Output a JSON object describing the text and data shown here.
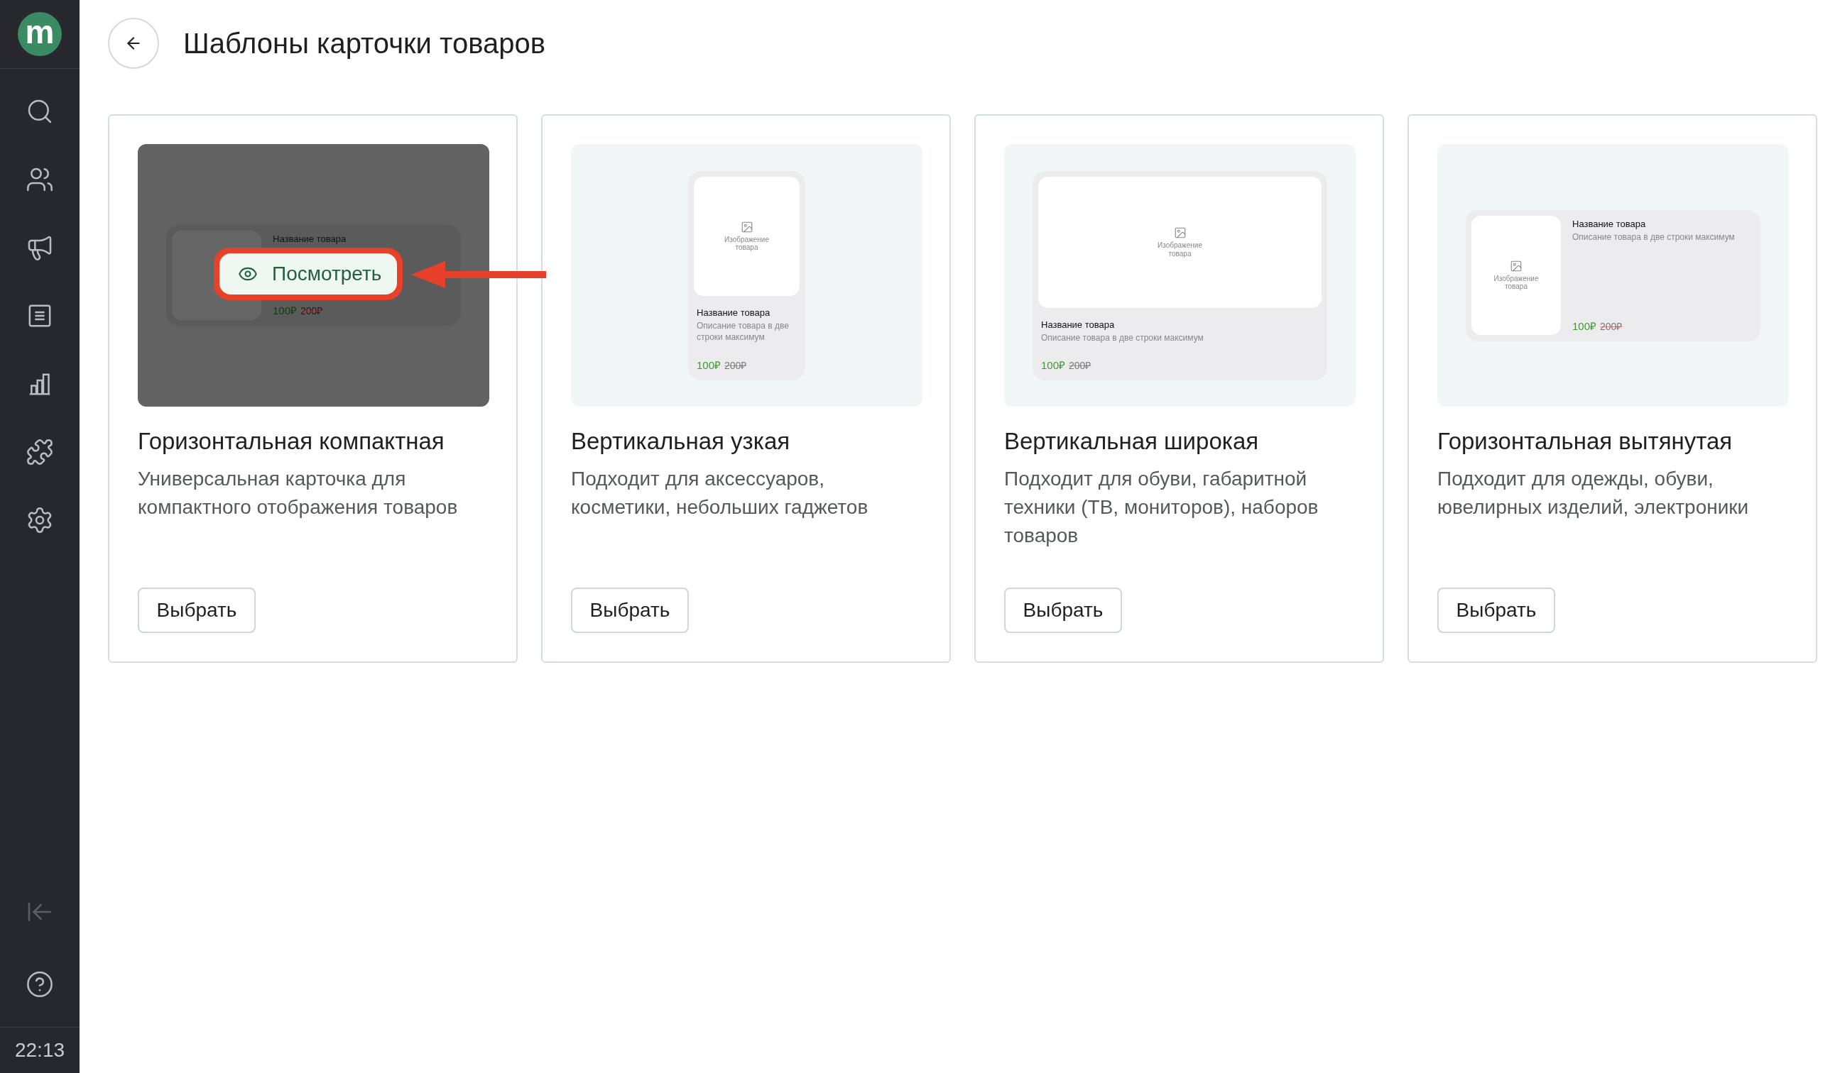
{
  "sidebar": {
    "logo": "m",
    "time": "22:13"
  },
  "header": {
    "title": "Шаблоны карточки товаров"
  },
  "templates": [
    {
      "kind": "horizontal-compact",
      "title": "Горизонтальная компактная",
      "description": "Универсальная карточка для компактного отображения товаров",
      "button": "Выбрать",
      "hovered": true,
      "highlighted": true,
      "overlay_button": "Посмотреть",
      "preview": {
        "name": "Название товара",
        "price": "100₽",
        "old_price": "200₽"
      }
    },
    {
      "kind": "vertical-narrow",
      "title": "Вертикальная узкая",
      "description": "Подходит для аксессуаров, косметики, небольших гаджетов",
      "button": "Выбрать",
      "hovered": false,
      "highlighted": false,
      "preview": {
        "image_label": "Изображение товара",
        "name": "Название товара",
        "description": "Описание товара в две строки максимум",
        "price": "100₽",
        "old_price": "200₽"
      }
    },
    {
      "kind": "vertical-wide",
      "title": "Вертикальная широкая",
      "description": "Подходит для обуви, габаритной техники (ТВ, мониторов), наборов товаров",
      "button": "Выбрать",
      "hovered": false,
      "highlighted": false,
      "preview": {
        "image_label": "Изображение товара",
        "name": "Название товара",
        "description": "Описание товара в две строки максимум",
        "price": "100₽",
        "old_price": "200₽"
      }
    },
    {
      "kind": "horizontal-stretched",
      "title": "Горизонтальная вытянутая",
      "description": "Подходит для одежды, обуви, ювелирных изделий, электроники",
      "button": "Выбрать",
      "hovered": false,
      "highlighted": false,
      "preview": {
        "image_label": "Изображение товара",
        "name": "Название товара",
        "description": "Описание товара в две строки максимум",
        "price": "100₽",
        "old_price": "200₽"
      }
    }
  ]
}
